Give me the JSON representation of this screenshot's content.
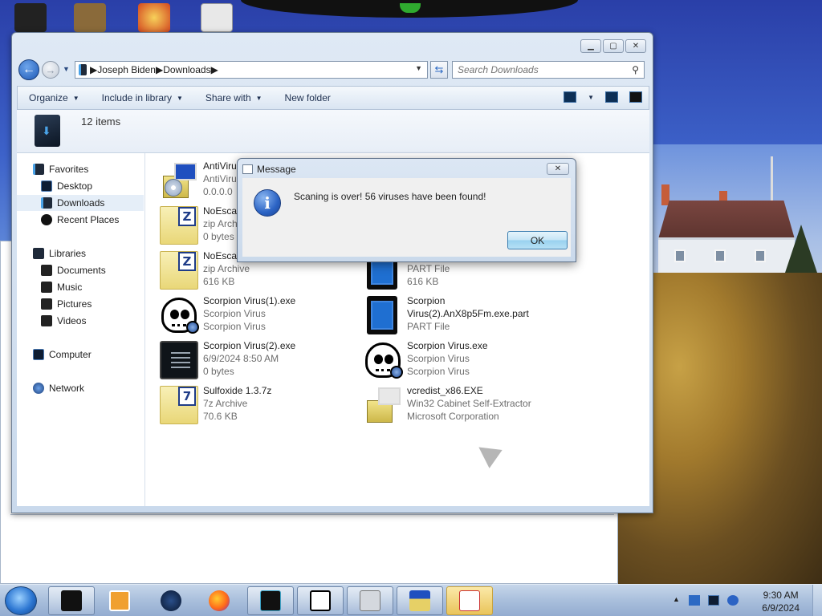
{
  "explorer": {
    "breadcrumb": [
      "Joseph Biden",
      "Downloads"
    ],
    "search_placeholder": "Search Downloads",
    "toolbar": {
      "organize": "Organize",
      "include_in_library": "Include in library",
      "share_with": "Share with",
      "new_folder": "New folder"
    },
    "item_count": "12 items",
    "nav": {
      "favorites": "Favorites",
      "desktop": "Desktop",
      "downloads": "Downloads",
      "recent_places": "Recent Places",
      "libraries": "Libraries",
      "documents": "Documents",
      "music": "Music",
      "pictures": "Pictures",
      "videos": "Videos",
      "computer": "Computer",
      "network": "Network"
    },
    "files": [
      {
        "name": "AntiViru",
        "type": "AntiViru",
        "info": "0.0.0.0",
        "icon": "installer-icon"
      },
      {
        "name": "NoEscap",
        "type": "zip Arch",
        "info": "0 bytes",
        "icon": "zip-archive-icon"
      },
      {
        "name": "NoEscap",
        "type": "zip Archive",
        "info": "616 KB",
        "icon": "zip-archive-icon"
      },
      {
        "name": "",
        "type": "PART File",
        "info": "616 KB",
        "icon": "part-file-icon"
      },
      {
        "name": "Scorpion Virus(1).exe",
        "type": "Scorpion Virus",
        "info": "Scorpion Virus",
        "icon": "skull-icon"
      },
      {
        "name": "Scorpion",
        "name2": "Virus(2).AnX8p5Fm.exe.part",
        "type": "PART File",
        "icon": "part-file-icon"
      },
      {
        "name": "Scorpion Virus(2).exe",
        "type": "6/9/2024 8:50 AM",
        "info": "0 bytes",
        "icon": "terminal-icon"
      },
      {
        "name": "Scorpion Virus.exe",
        "type": "Scorpion Virus",
        "info": "Scorpion Virus",
        "icon": "skull-icon"
      },
      {
        "name": "Sulfoxide 1.3.7z",
        "type": "7z Archive",
        "info": "70.6 KB",
        "icon": "7z-archive-icon"
      },
      {
        "name": "vcredist_x86.EXE",
        "type": "Win32 Cabinet Self-Extractor",
        "info": "Microsoft Corporation",
        "icon": "installer-icon"
      }
    ]
  },
  "dialog": {
    "title": "Message",
    "message": "Scaning is over! 56 viruses have been found!",
    "ok": "OK"
  },
  "taskbar": {
    "time": "9:30 AM",
    "date": "6/9/2024",
    "apps": [
      "explorer-icon",
      "media-player-icon",
      "globe-icon",
      "firefox-icon",
      "waveform-icon",
      "7zip-icon",
      "settings-icon",
      "installer-icon",
      "java-icon"
    ]
  },
  "colors": {
    "accent": "#2b63c4",
    "taskbar": "#a9bfdc",
    "dialog_ok_border": "#3c7fb1"
  }
}
